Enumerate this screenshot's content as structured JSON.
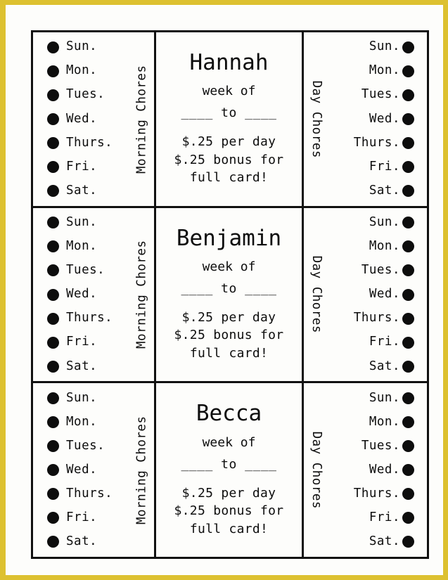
{
  "page": {
    "frame_color": "#ddc130",
    "ink_color": "#0d0d0d",
    "paper_color": "#fdfdfb"
  },
  "labels": {
    "morning_chores": "Morning Chores",
    "day_chores": "Day Chores",
    "week_of": "week of",
    "date_range": "____ to ____",
    "pay_per_day": "$.25 per day",
    "bonus_line": "$.25 bonus for",
    "bonus_line2": "full card!"
  },
  "days": [
    "Sun.",
    "Mon.",
    "Tues.",
    "Wed.",
    "Thurs.",
    "Fri.",
    "Sat."
  ],
  "cards": [
    {
      "name": "Hannah"
    },
    {
      "name": "Benjamin"
    },
    {
      "name": "Becca"
    }
  ]
}
